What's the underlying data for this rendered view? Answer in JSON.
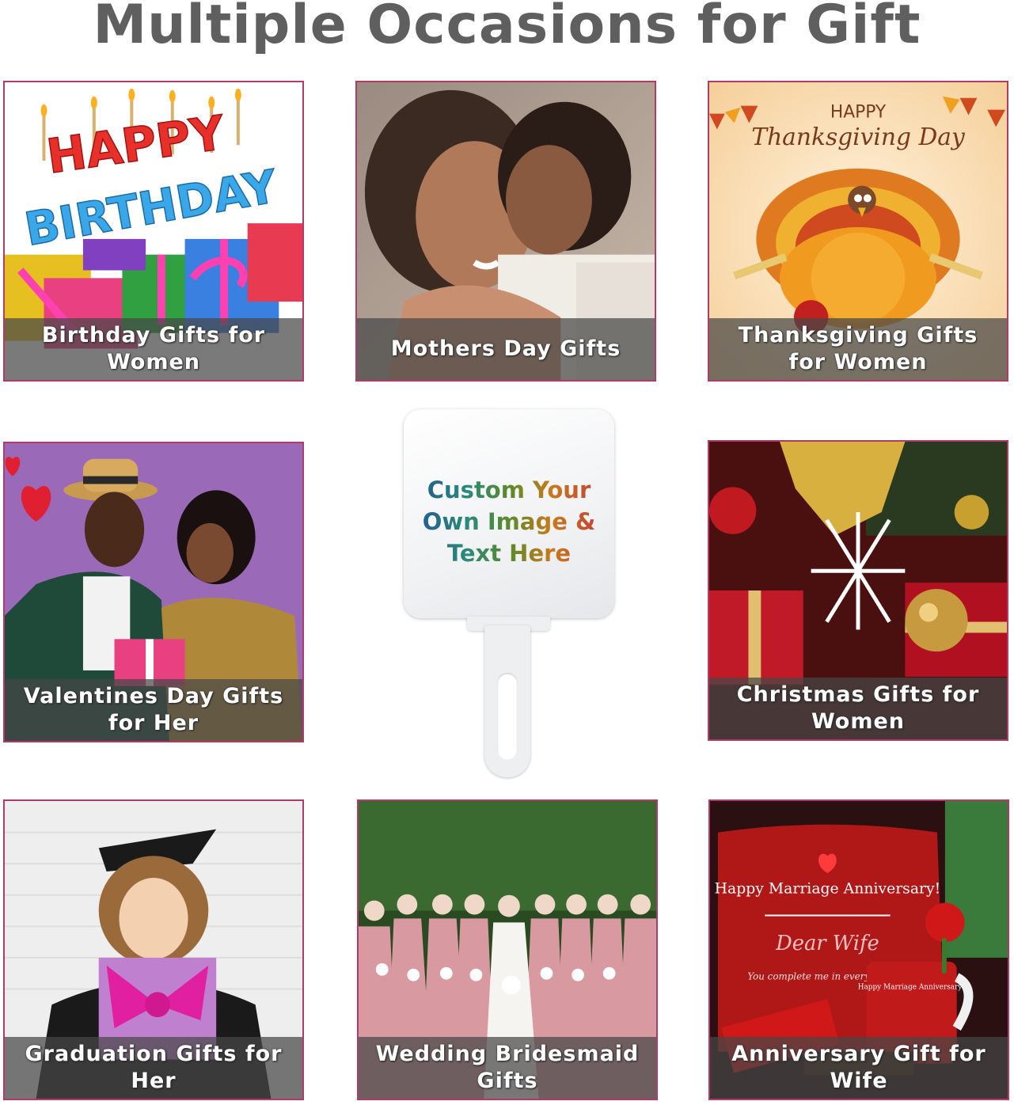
{
  "heading": "Multiple Occasions for Gift",
  "tiles": [
    {
      "caption": "Birthday Gifts for Women"
    },
    {
      "caption": "Mothers Day Gifts"
    },
    {
      "caption": "Thanksgiving Gifts for Women"
    },
    {
      "caption": "Valentines Day Gifts for Her"
    },
    {
      "caption": "Christmas Gifts for Women"
    },
    {
      "caption": "Graduation Gifts for Her"
    },
    {
      "caption": "Wedding Bridesmaid Gifts"
    },
    {
      "caption": "Anniversary Gift for Wife"
    }
  ],
  "artwork_text": {
    "birthday_word1": "HAPPY",
    "birthday_word2": "BIRTHDAY",
    "thanksgiving_line1": "HAPPY",
    "thanksgiving_line2": "Thanksgiving Day",
    "anniversary_banner": "Happy Marriage Anniversary!",
    "anniversary_script": "Dear Wife",
    "anniversary_sub": "You complete me in every way",
    "mug_text": "Happy Marriage Anniversary!"
  },
  "fan": {
    "text": "Custom Your Own Image & Text Here"
  },
  "colors": {
    "heading": "#5f5f5f",
    "tile_border": "#b03a6a",
    "caption_bg": "rgba(70,70,70,0.72)"
  }
}
